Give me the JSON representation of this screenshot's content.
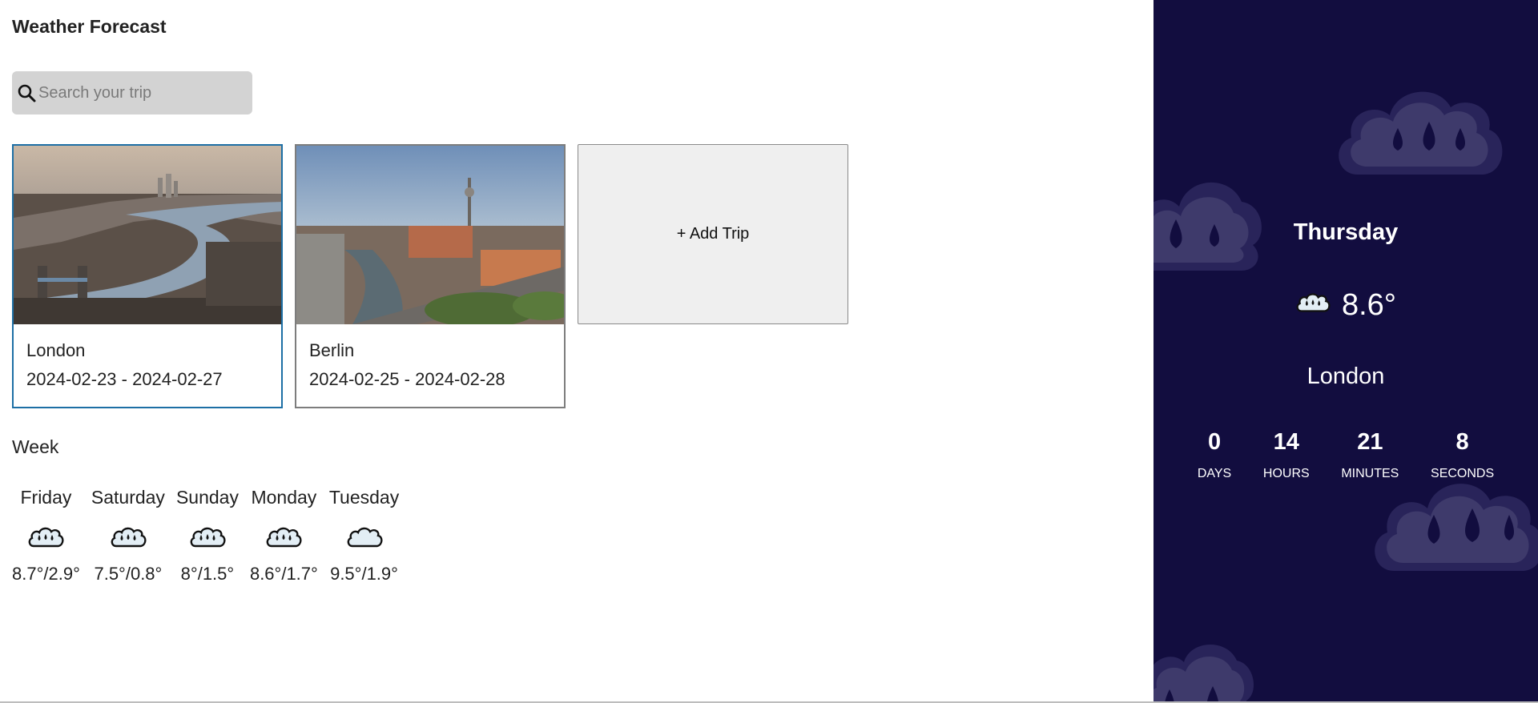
{
  "header": {
    "title_light": "Weather",
    "title_bold": "Forecast"
  },
  "search": {
    "placeholder": "Search your trip",
    "icon": "search-icon"
  },
  "trips": [
    {
      "city": "London",
      "dates": "2024-02-23 - 2024-02-27",
      "selected": true
    },
    {
      "city": "Berlin",
      "dates": "2024-02-25 - 2024-02-28",
      "selected": false
    }
  ],
  "add_trip": {
    "label": "+ Add Trip"
  },
  "week": {
    "label": "Week",
    "days": [
      {
        "name": "Friday",
        "icon": "rain-cloud-icon",
        "temps": "8.7°/2.9°"
      },
      {
        "name": "Saturday",
        "icon": "rain-cloud-icon",
        "temps": "7.5°/0.8°"
      },
      {
        "name": "Sunday",
        "icon": "rain-cloud-icon",
        "temps": "8°/1.5°"
      },
      {
        "name": "Monday",
        "icon": "rain-cloud-icon",
        "temps": "8.6°/1.7°"
      },
      {
        "name": "Tuesday",
        "icon": "cloud-icon",
        "temps": "9.5°/1.9°"
      }
    ]
  },
  "today": {
    "day": "Thursday",
    "icon": "rain-cloud-icon",
    "temperature": "8.6°",
    "city": "London",
    "countdown": [
      {
        "value": "0",
        "unit": "DAYS"
      },
      {
        "value": "14",
        "unit": "HOURS"
      },
      {
        "value": "21",
        "unit": "MINUTES"
      },
      {
        "value": "8",
        "unit": "SECONDS"
      }
    ]
  },
  "colors": {
    "panel_bg": "#120d3f",
    "cloud_bg": "#3e3a6b",
    "selected_border": "#1d6fa5",
    "search_bg": "#d3d3d3"
  }
}
